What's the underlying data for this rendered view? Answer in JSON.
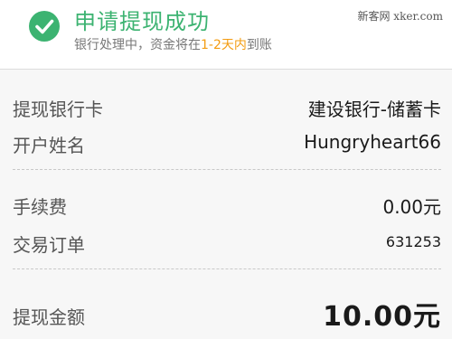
{
  "header": {
    "title": "申请提现成功",
    "subtitle_prefix": "银行处理中，资金将在",
    "subtitle_highlight": "1-2天内",
    "subtitle_suffix": "到账",
    "watermark": "新客网 xker.com",
    "icon": "check-circle-icon",
    "accent_color": "#3cb371",
    "highlight_color": "#f39c12"
  },
  "details": {
    "bank_card_label": "提现银行卡",
    "bank_card_value": "建设银行-储蓄卡",
    "account_name_label": "开户姓名",
    "account_name_value": "Hungryheart66",
    "fee_label": "手续费",
    "fee_value": "0.00元",
    "order_label": "交易订单",
    "order_value": "631253",
    "amount_label": "提现金额",
    "amount_value": "10.00元"
  }
}
